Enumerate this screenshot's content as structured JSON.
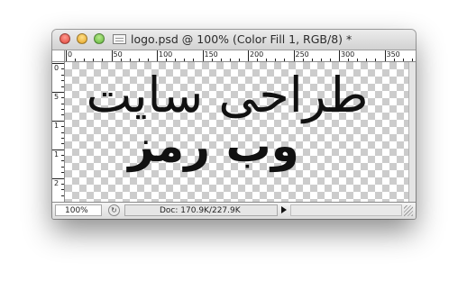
{
  "window": {
    "title": "logo.psd @ 100% (Color Fill 1, RGB/8) *"
  },
  "ruler_top": {
    "labels": [
      "0",
      "50",
      "100",
      "150",
      "200",
      "250",
      "300",
      "350"
    ]
  },
  "ruler_left": {
    "labels": [
      "0",
      "5",
      "1",
      "1",
      "2"
    ]
  },
  "canvas": {
    "line1": "طراحی سایت",
    "line2": "وب رمز"
  },
  "statusbar": {
    "zoom": "100%",
    "doc_info": "Doc: 170.9K/227.9K"
  },
  "colors": {
    "text": "#111111",
    "checker_dark": "#cccccc",
    "checker_light": "#ffffff"
  }
}
